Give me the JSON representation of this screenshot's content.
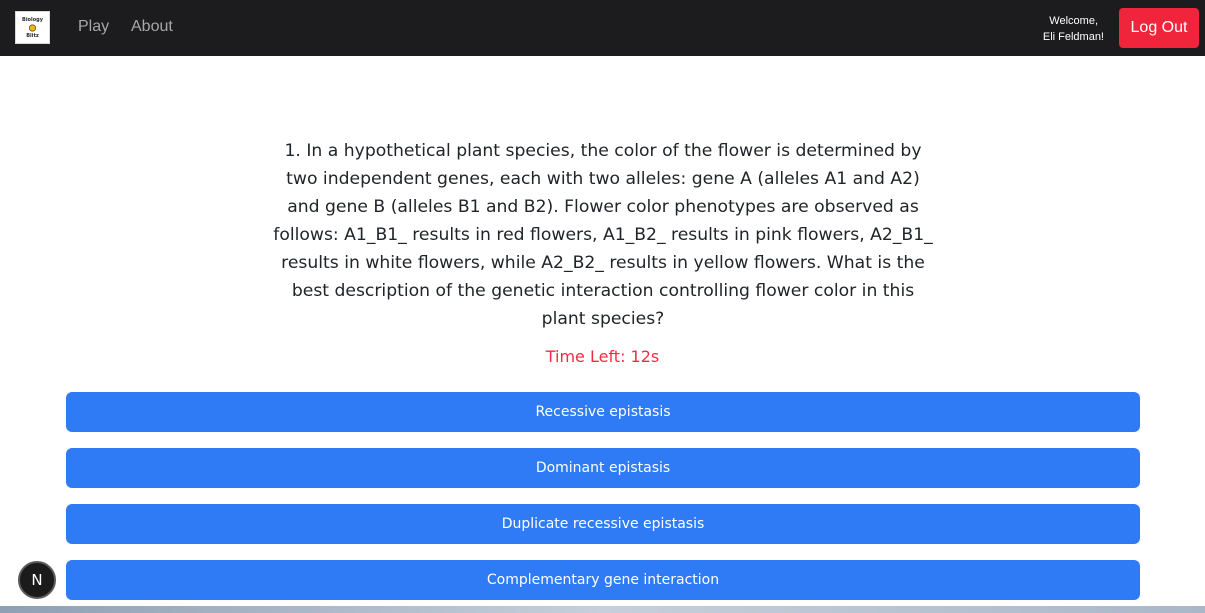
{
  "navbar": {
    "logo_top": "Biology",
    "logo_bottom": "Blitz",
    "links": [
      {
        "label": "Play"
      },
      {
        "label": "About"
      }
    ],
    "welcome_line1": "Welcome,",
    "welcome_line2": "Eli Feldman!",
    "logout_label": "Log Out",
    "background": "#1c1c1e",
    "logout_color": "#f0243a"
  },
  "quiz": {
    "question": "1. In a hypothetical plant species, the color of the flower is determined by two independent genes, each with two alleles: gene A (alleles A1 and A2) and gene B (alleles B1 and B2). Flower color phenotypes are observed as follows: A1_B1_ results in red flowers, A1_B2_ results in pink flowers, A2_B1_ results in white flowers, while A2_B2_ results in yellow flowers. What is the best description of the genetic interaction controlling flower color in this plant species?",
    "timer": "Time Left: 12s",
    "answers": [
      {
        "label": "Recessive epistasis"
      },
      {
        "label": "Dominant epistasis"
      },
      {
        "label": "Duplicate recessive epistasis"
      },
      {
        "label": "Complementary gene interaction"
      }
    ],
    "answer_color": "#2f7bf5",
    "timer_color": "#ef2d41"
  },
  "dev_badge": {
    "letter": "N",
    "icon": "nextjs-icon"
  }
}
